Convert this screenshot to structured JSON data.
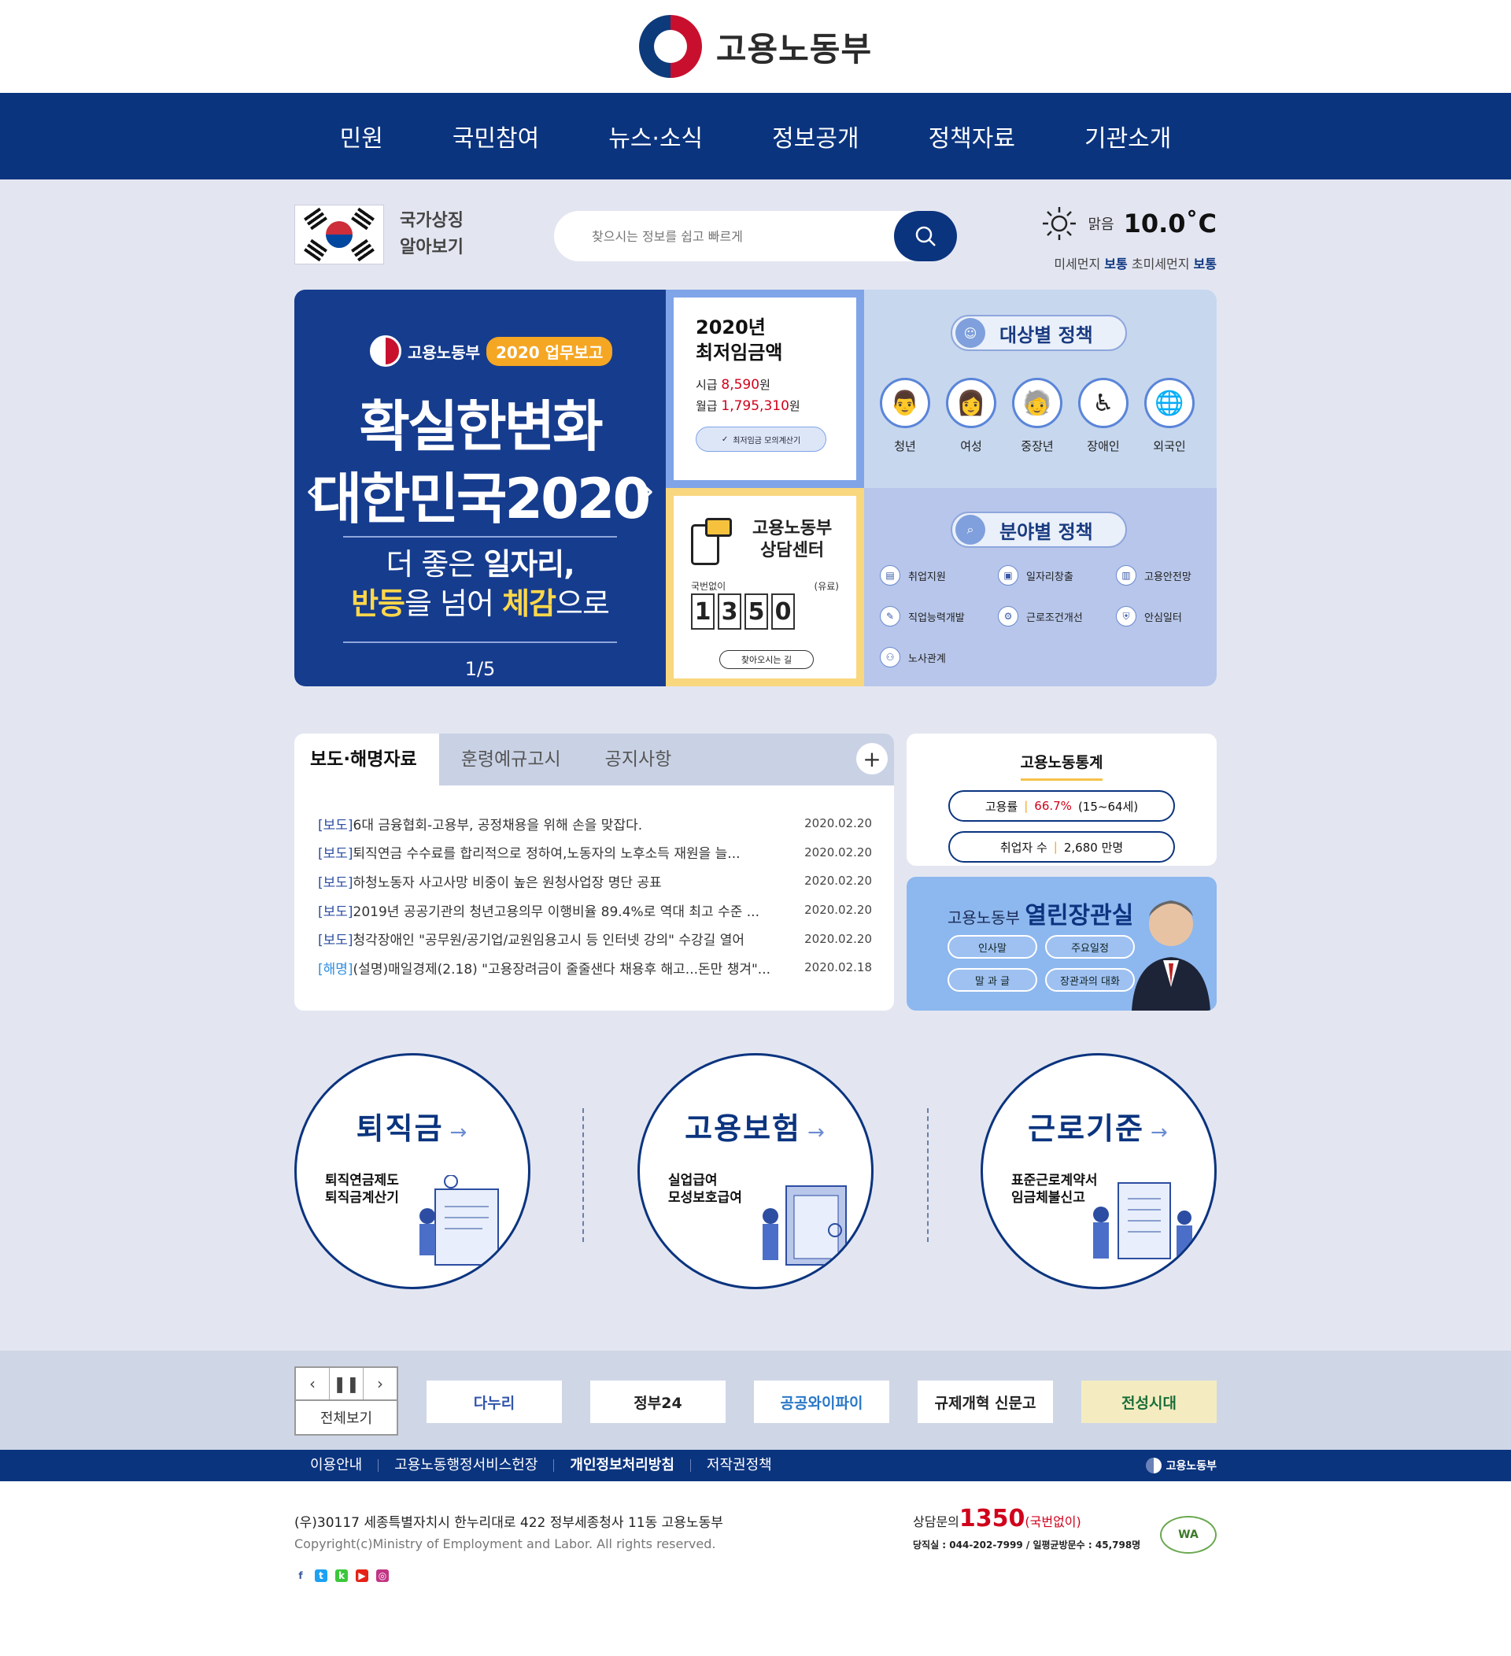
{
  "header": {
    "org_name": "고용노동부"
  },
  "gnb": [
    "민원",
    "국민참여",
    "뉴스·소식",
    "정보공개",
    "정책자료",
    "기관소개"
  ],
  "symbol": {
    "label_line1": "국가상징",
    "label_line2": "알아보기"
  },
  "search": {
    "placeholder": "찾으시는 정보를 쉽고 빠르게"
  },
  "weather": {
    "condition": "맑음",
    "temperature": "10.0˚C",
    "dust_label": "미세먼지",
    "dust_value": "보통",
    "fine_dust_label": "초미세먼지",
    "fine_dust_value": "보통"
  },
  "banner": {
    "org": "고용노동부",
    "tag": "2020 업무보고",
    "headline_line1": "확실한변화",
    "headline_line2": "대한민국2020",
    "sub_line1_a": "더 좋은 ",
    "sub_line1_b": "일자리,",
    "sub_line2_a": "반등",
    "sub_line2_b": "을 넘어 ",
    "sub_line2_c": "체감",
    "sub_line2_d": "으로",
    "counter": "1/5"
  },
  "min_wage": {
    "title_line1": "2020년",
    "title_line2": "최저임금액",
    "hourly_label": "시급",
    "hourly_value": "8,590",
    "monthly_label": "월급",
    "monthly_value": "1,795,310",
    "unit": "원",
    "calc_button": "최저임금 모의계산기"
  },
  "counsel": {
    "title_line1": "고용노동부",
    "title_line2": "상담센터",
    "no_area_code": "국번없이",
    "paid": "(유료)",
    "digits": [
      "1",
      "3",
      "5",
      "0"
    ],
    "directions_button": "찾아오시는 길"
  },
  "target_policy": {
    "title": "대상별 정책",
    "items": [
      "청년",
      "여성",
      "중장년",
      "장애인",
      "외국인"
    ]
  },
  "field_policy": {
    "title": "분야별 정책",
    "items": [
      "취업지원",
      "일자리창출",
      "고용안전망",
      "직업능력개발",
      "근로조건개선",
      "안심일터",
      "노사관계"
    ]
  },
  "board": {
    "tabs": [
      "보도·해명자료",
      "훈령예규고시",
      "공지사항"
    ],
    "plus": "+",
    "rows": [
      {
        "tag": "[보도]",
        "title": "6대 금융협회-고용부, 공정채용을 위해 손을 맞잡다.",
        "date": "2020.02.20"
      },
      {
        "tag": "[보도]",
        "title": "퇴직연금 수수료를 합리적으로 정하여,노동자의 노후소득 재원을 늘...",
        "date": "2020.02.20"
      },
      {
        "tag": "[보도]",
        "title": "하청노동자 사고사망 비중이 높은 원청사업장 명단 공표",
        "date": "2020.02.20"
      },
      {
        "tag": "[보도]",
        "title": "2019년 공공기관의 청년고용의무 이행비율 89.4%로 역대 최고 수준 ...",
        "date": "2020.02.20"
      },
      {
        "tag": "[보도]",
        "title": "청각장애인 \"공무원/공기업/교원임용고시 등 인터넷 강의\" 수강길 열어",
        "date": "2020.02.20"
      },
      {
        "tag": "[해명]",
        "title": "(설명)매일경제(2.18) \"고용장려금이 줄줄샌다 채용후 해고...돈만 챙겨\"...",
        "date": "2020.02.18"
      }
    ]
  },
  "stats": {
    "title": "고용노동통계",
    "rate_label": "고용률",
    "rate_value": "66.7%",
    "rate_note": "(15~64세)",
    "employed_label": "취업자 수",
    "employed_value": "2,680 만명"
  },
  "minister": {
    "prefix": "고용노동부",
    "title": "열린장관실",
    "buttons": [
      "인사말",
      "주요일정",
      "말 과 글",
      "장관과의 대화"
    ]
  },
  "services": [
    {
      "title": "퇴직금",
      "line1": "퇴직연금제도",
      "line2": "퇴직금계산기"
    },
    {
      "title": "고용보험",
      "line1": "실업급여",
      "line2": "모성보호급여"
    },
    {
      "title": "근로기준",
      "line1": "표준근로계약서",
      "line2": "임금체불신고"
    }
  ],
  "banner_bar": {
    "view_all": "전체보기",
    "logos": [
      "다누리",
      "정부24",
      "공공와이파이",
      "규제개혁 신문고",
      "전성시대"
    ]
  },
  "footer_nav": {
    "links": [
      "이용안내",
      "고용노동행정서비스헌장",
      "개인정보처리방침",
      "저작권정책"
    ],
    "logo": "고용노동부"
  },
  "footer": {
    "address": "(우)30117 세종특별자치시 한누리대로 422 정부세종청사 11동 고용노동부",
    "copyright": "Copyright(c)Ministry of Employment and Labor. All rights reserved.",
    "call_label": "상담문의",
    "call_number": "1350",
    "call_note": "(국번없이)",
    "duty": "당직실 : 044-202-7999 / 일평균방문수 : 45,798명",
    "wa": "WA"
  },
  "colors": {
    "navy": "#0b347f",
    "bg": "#e3e6f1",
    "red": "#d0021b"
  }
}
